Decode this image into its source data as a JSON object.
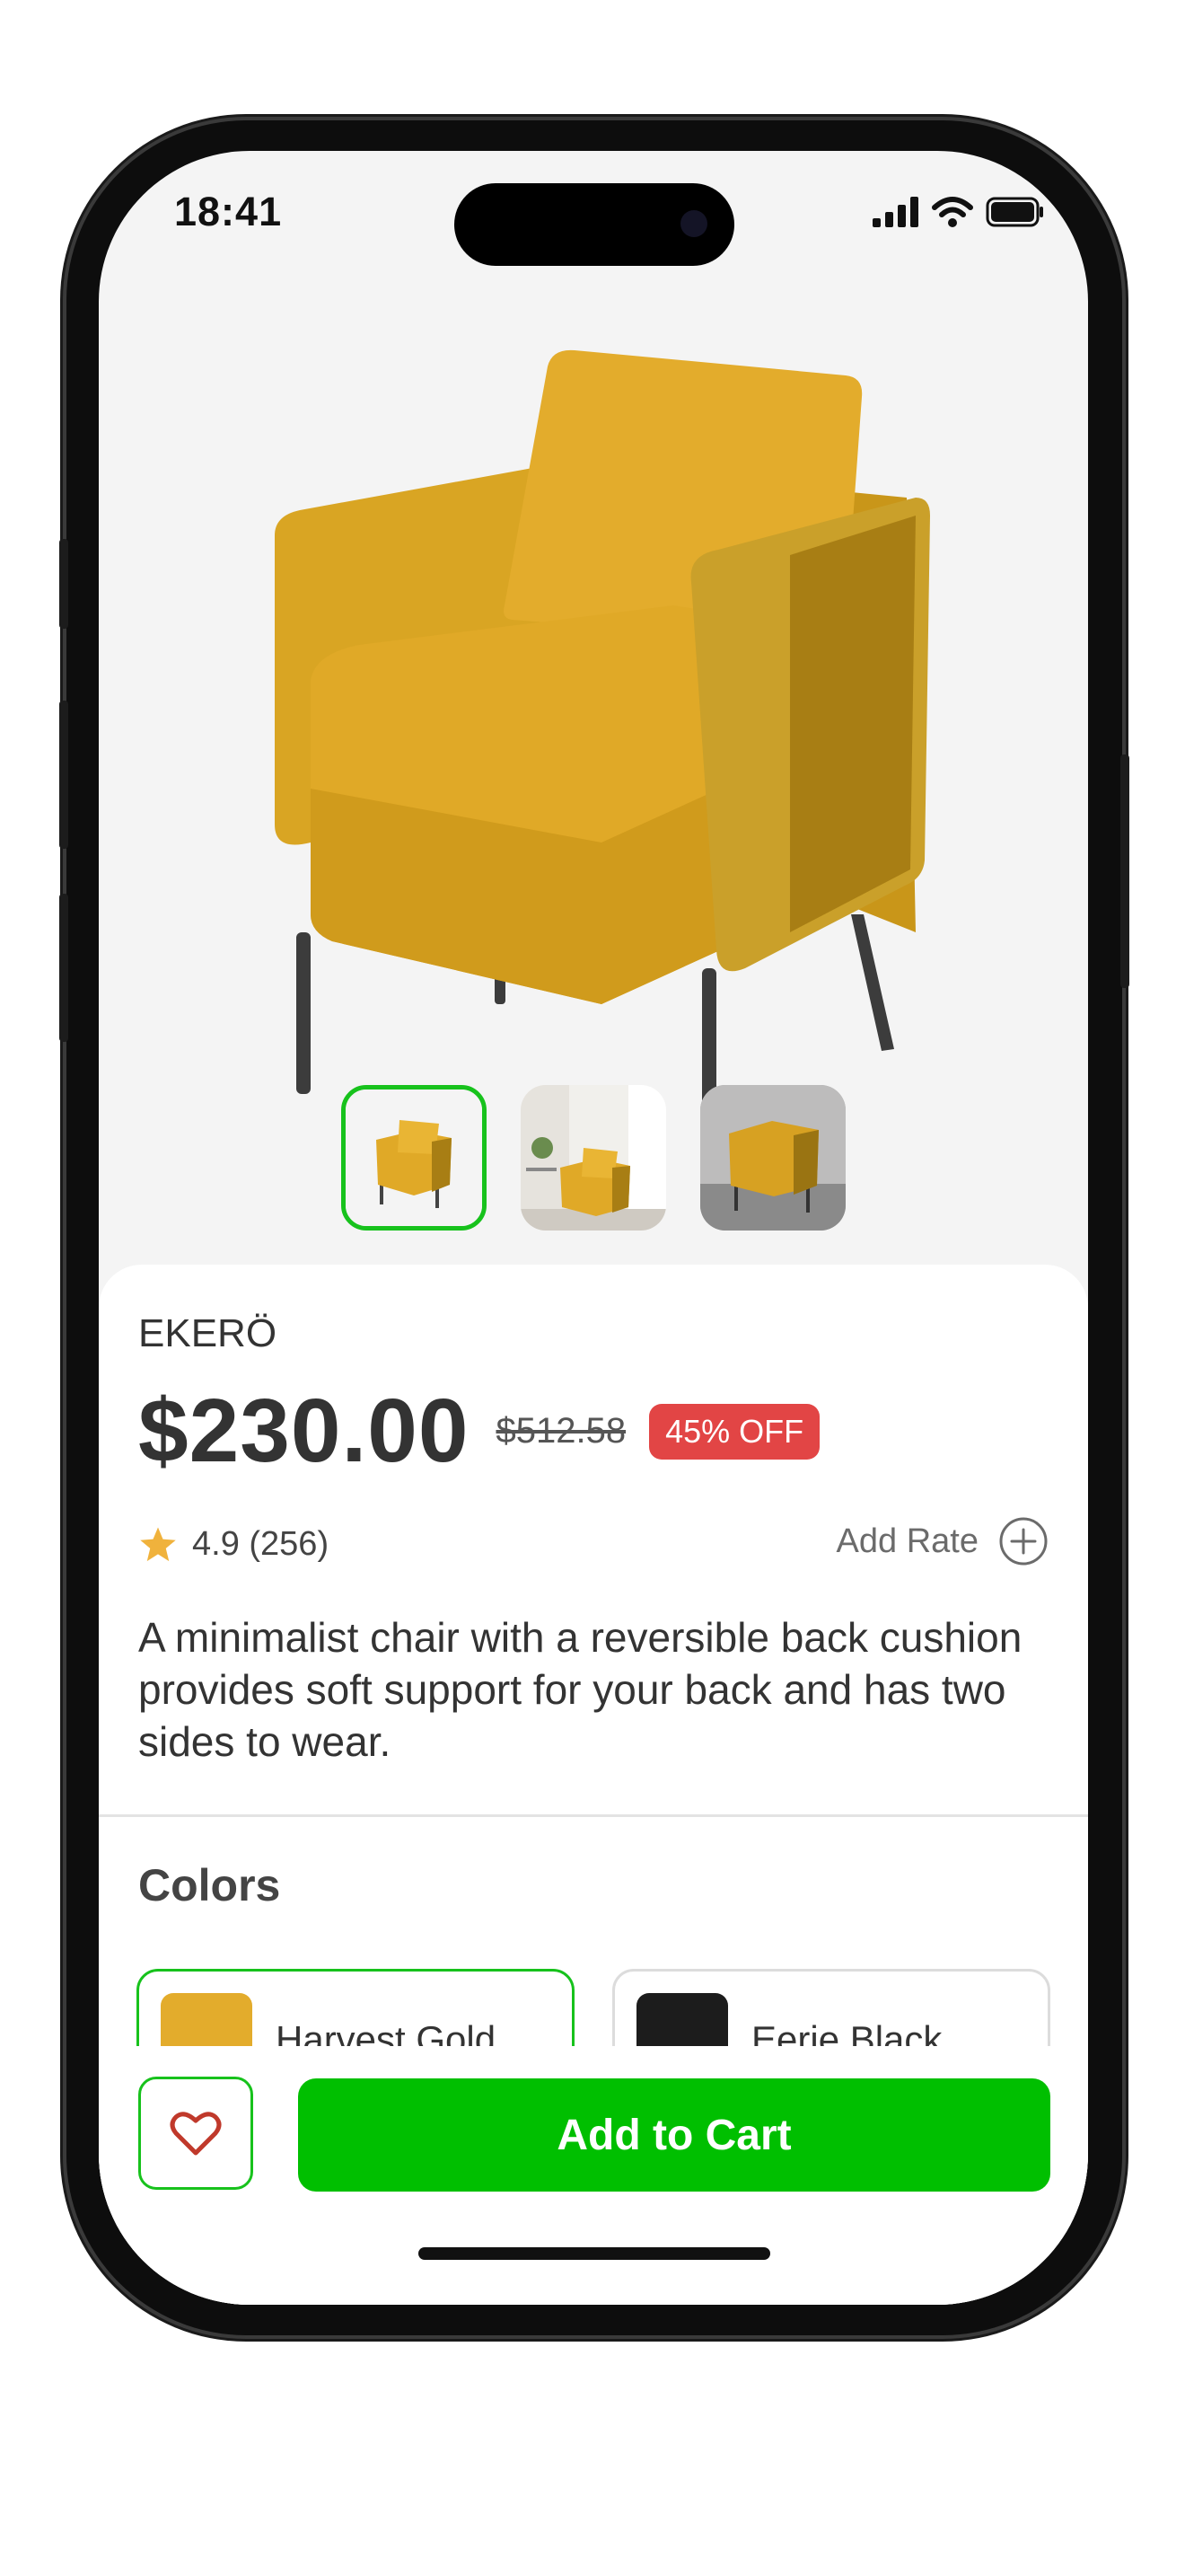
{
  "status_bar": {
    "time": "18:41"
  },
  "product": {
    "name": "EKERÖ",
    "price": "$230.00",
    "old_price": "$512.58",
    "discount_badge": "45% OFF",
    "rating": "4.9 (256)",
    "add_rate_label": "Add Rate",
    "description": "A minimalist chair with a reversible back cushion provides soft support for your back and has two sides to wear.",
    "thumbnails": [
      {
        "name": "thumb-studio",
        "selected": true
      },
      {
        "name": "thumb-room-bright",
        "selected": false
      },
      {
        "name": "thumb-room-gray",
        "selected": false
      }
    ]
  },
  "colors": {
    "title": "Colors",
    "options": [
      {
        "label": "Harvest Gold",
        "swatch": "#e3ac2c",
        "selected": true
      },
      {
        "label": "Eerie Black",
        "swatch": "#1c1c1c",
        "selected": false
      }
    ]
  },
  "actions": {
    "add_to_cart": "Add to Cart"
  },
  "theme": {
    "accent": "#00bf00",
    "selection_border": "#17c21c",
    "discount": "#e24545",
    "star": "#f0b23c",
    "heart": "#c0392b"
  },
  "icons": [
    "signal-icon",
    "wifi-icon",
    "battery-icon",
    "star-icon",
    "add-circle-icon",
    "heart-icon"
  ]
}
